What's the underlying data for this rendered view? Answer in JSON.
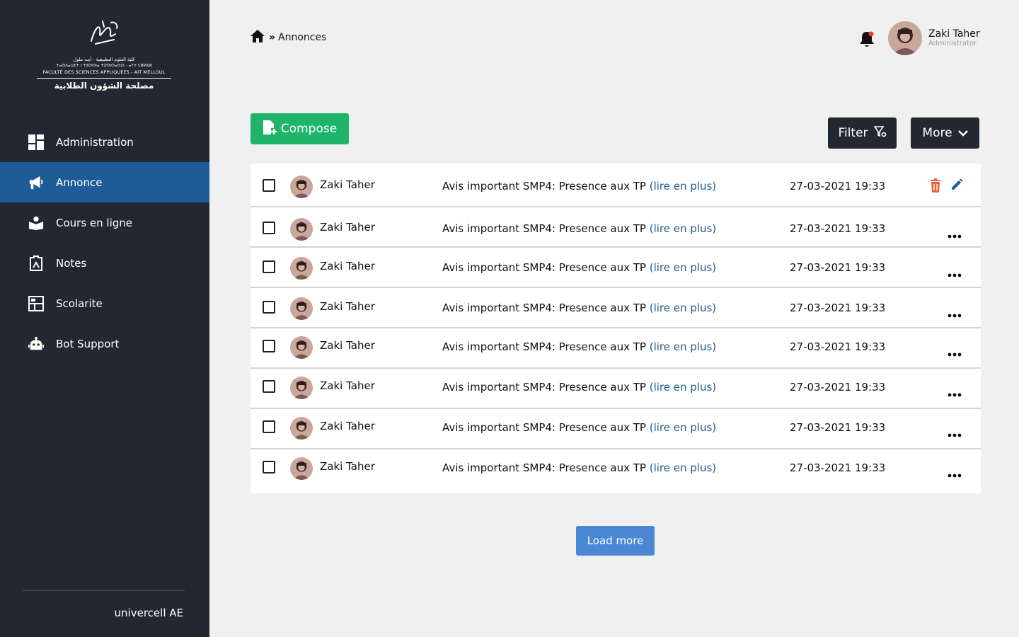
{
  "sidebar": {
    "logo": {
      "arabic_line": "كلية العلوم التطبيقية - أيت ملول",
      "tifinagh_line": "ⵜⴰⵙⴷⴰⵡⵉⵜ ⵏ ⵜⵓⵙⵙⵏⴰ ⵜⵉⵙⵏⵙⴰⵙⵉⵏ - ⴰⵢⵜ ⵎⵍⵍⵓⵍ",
      "french_line": "FACULTÉ DES SCIENCES APPLIQUÉES - AIT MELLOUL",
      "service_line": "مصلحة الشؤون الطلابية"
    },
    "items": [
      {
        "label": "Administration",
        "icon": "dashboard-icon"
      },
      {
        "label": "Annonce",
        "icon": "megaphone-icon"
      },
      {
        "label": "Cours en ligne",
        "icon": "reading-icon"
      },
      {
        "label": "Notes",
        "icon": "clipboard-icon"
      },
      {
        "label": "Scolarite",
        "icon": "layout-icon"
      },
      {
        "label": "Bot Support",
        "icon": "robot-icon"
      }
    ],
    "active_index": 1,
    "footer": "univercell AE"
  },
  "header": {
    "breadcrumb": "Annonces",
    "user_name": "Zaki Taher",
    "user_role": "Administrator"
  },
  "toolbar": {
    "compose_label": "Compose",
    "filter_label": "Filter",
    "more_label": "More"
  },
  "list": {
    "rows": [
      {
        "author": "Zaki Taher",
        "subject": "Avis important SMP4: Presence aux TP ",
        "link": "(lire en plus)",
        "date": "27-03-2021 19:33",
        "actions": "edit"
      },
      {
        "author": "Zaki Taher",
        "subject": "Avis important SMP4: Presence aux TP ",
        "link": "(lire en plus)",
        "date": "27-03-2021 19:33",
        "actions": "more"
      },
      {
        "author": "Zaki Taher",
        "subject": "Avis important SMP4: Presence aux TP ",
        "link": "(lire en plus)",
        "date": "27-03-2021 19:33",
        "actions": "more"
      },
      {
        "author": "Zaki Taher",
        "subject": "Avis important SMP4: Presence aux TP ",
        "link": "(lire en plus)",
        "date": "27-03-2021 19:33",
        "actions": "more"
      },
      {
        "author": "Zaki Taher",
        "subject": "Avis important SMP4: Presence aux TP ",
        "link": "(lire en plus)",
        "date": "27-03-2021 19:33",
        "actions": "more"
      },
      {
        "author": "Zaki Taher",
        "subject": "Avis important SMP4: Presence aux TP ",
        "link": "(lire en plus)",
        "date": "27-03-2021 19:33",
        "actions": "more"
      },
      {
        "author": "Zaki Taher",
        "subject": "Avis important SMP4: Presence aux TP ",
        "link": "(lire en plus)",
        "date": "27-03-2021 19:33",
        "actions": "more"
      },
      {
        "author": "Zaki Taher",
        "subject": "Avis important SMP4: Presence aux TP ",
        "link": "(lire en plus)",
        "date": "27-03-2021 19:33",
        "actions": "more"
      }
    ],
    "load_more_label": "Load more"
  },
  "colors": {
    "sidebar_bg": "#222831",
    "active_bg": "#1f5b96",
    "compose_green": "#1fb46a",
    "link_blue": "#1f5b96",
    "trash_orange": "#e5643c",
    "load_more_blue": "#4a88d6"
  }
}
